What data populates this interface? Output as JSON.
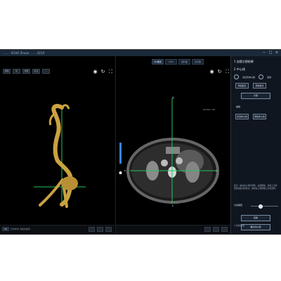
{
  "window": {
    "title": "…… · ECHO Zhuan · … · 0219",
    "controls": [
      "−",
      "□",
      "×"
    ]
  },
  "toolbar": {
    "left_items": [
      "视图",
      "切",
      "测量",
      "标注",
      "…"
    ],
    "view_tabs": [
      "3D重建",
      "MPR",
      "冠状面",
      "矢状面"
    ],
    "active_tab_index": 0
  },
  "left_pane": {
    "footer": {
      "icon_label": "3D",
      "text": "仅供参考 请结合临床 …",
      "status": [
        "…",
        "…",
        "…"
      ]
    }
  },
  "middle_pane": {
    "footer": {
      "status": [
        "…",
        "…",
        "…"
      ]
    },
    "view_label": "A",
    "scale_label": "W:400 L:40",
    "slice_labels": [
      "R",
      "L",
      "P"
    ]
  },
  "right_panel": {
    "title": "1 血管分割结果",
    "section2": "2 中心线",
    "radio_options": [
      "交互式中心线",
      "自动"
    ],
    "chips": [
      "添加起点",
      "添加终点"
    ],
    "generate": "计算",
    "edit_label": "编辑",
    "mode_chips": [
      "切割中心线",
      "添加中心线"
    ],
    "hint": "提示：拖动中心线可调整，右键删除，使用上方按钮添加起点和终点，或者在三维视图上点击选择。",
    "threshold_label": "分割阈值",
    "apply_btn": "应用",
    "confirm_btn": "确认中心线",
    "footer_note": "3 完成报告"
  },
  "accent_colors": {
    "app_frame": "#050505",
    "panel_bg": "#10161f",
    "vessel": "#caa23f",
    "crosshair_green": "#22c55e",
    "crosshair_blue": "#3b82f6"
  }
}
